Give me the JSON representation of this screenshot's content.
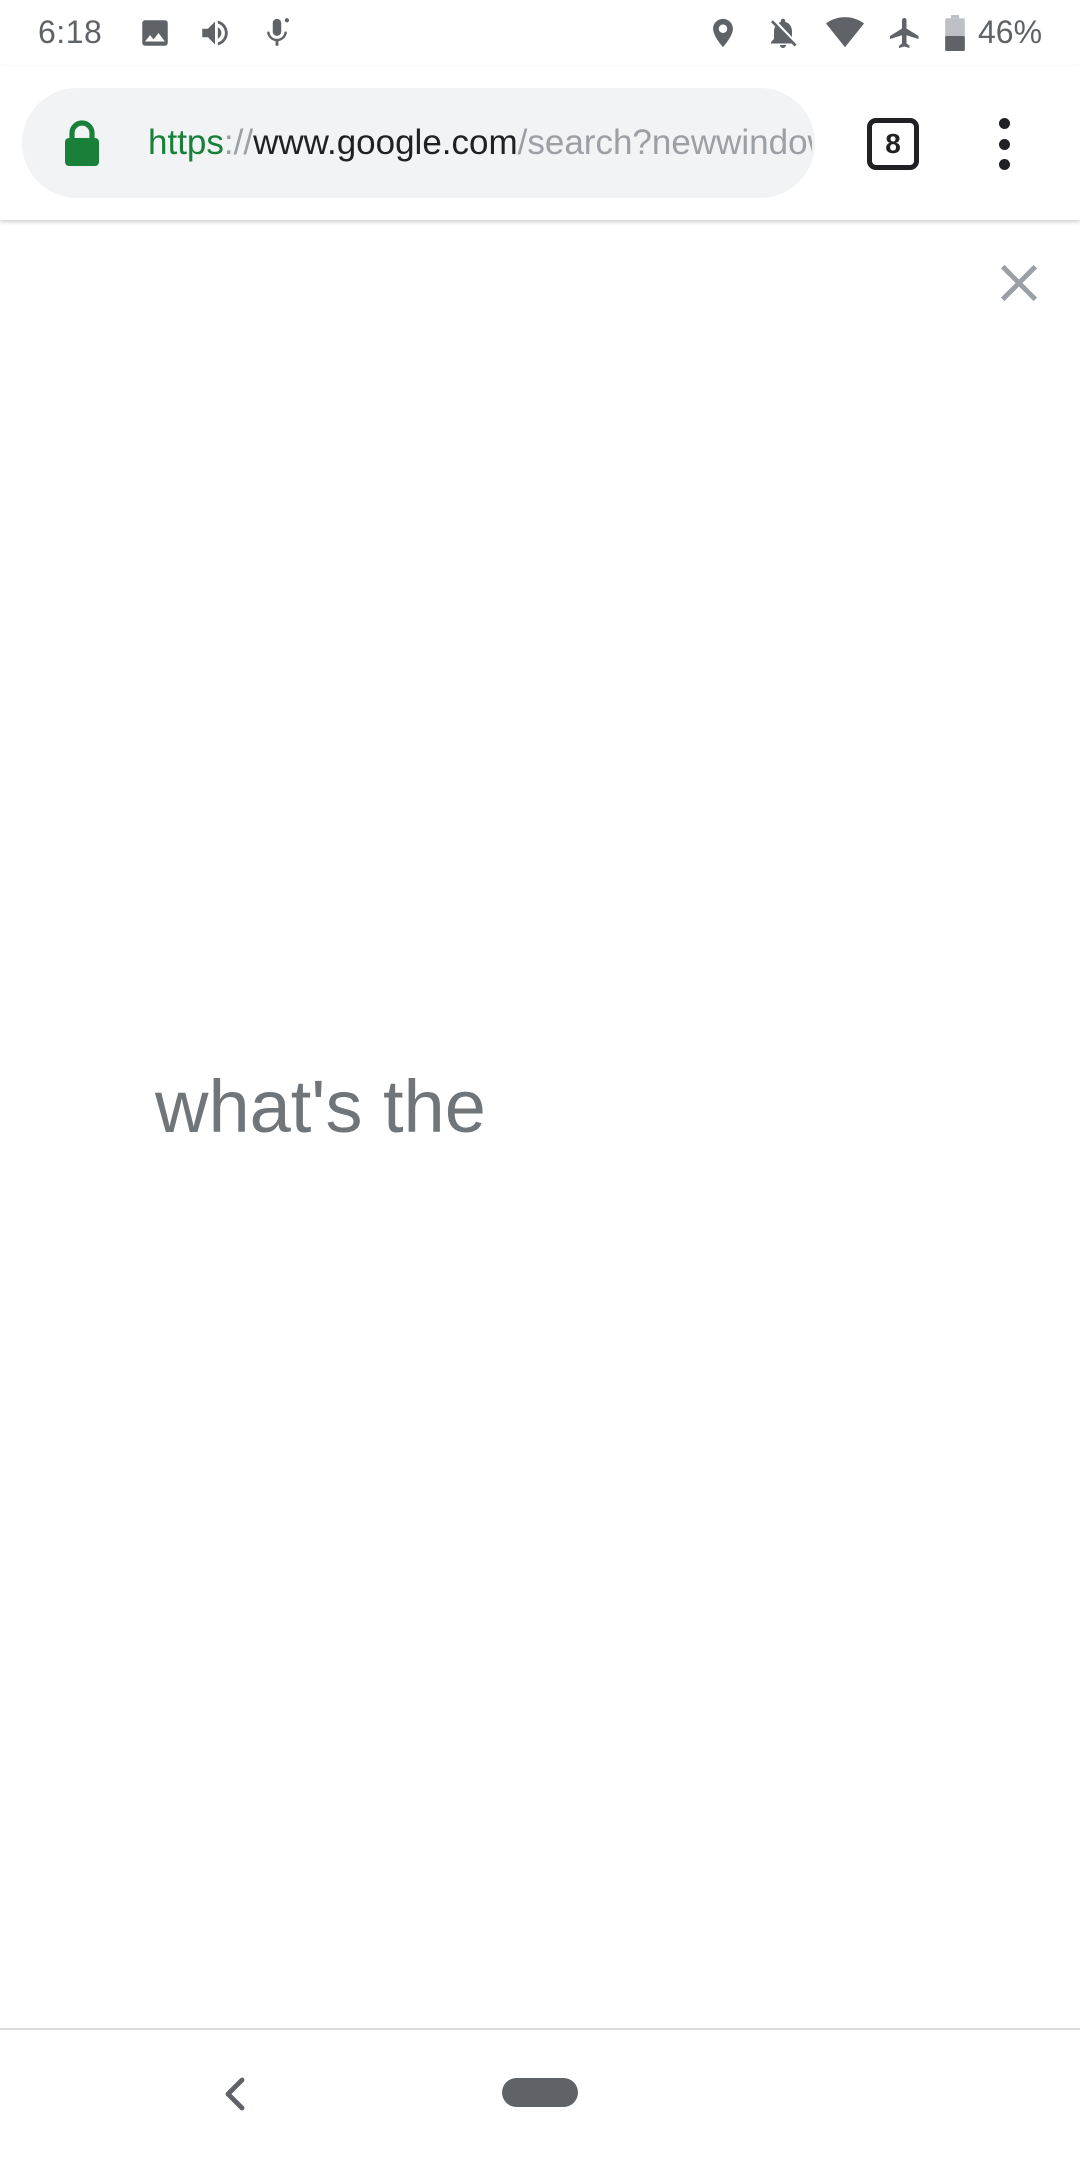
{
  "status_bar": {
    "time": "6:18",
    "battery_percent": "46%",
    "battery_level": 0.46,
    "icons": [
      "image-icon",
      "volume-icon",
      "mic-icon",
      "location-icon",
      "notifications-off-icon",
      "wifi-icon",
      "airplane-icon",
      "battery-icon"
    ]
  },
  "toolbar": {
    "url": {
      "scheme": "https",
      "separator": "://",
      "host": "www.google.com",
      "path": "/search?newwindow"
    },
    "tab_count": "8",
    "lock_icon": "lock-icon",
    "menu_icon": "more-vert-icon"
  },
  "content": {
    "query_text": "what's the",
    "close_icon": "close-icon"
  },
  "nav_bar": {
    "back_icon": "back-chevron-icon",
    "home_icon": "home-pill"
  },
  "colors": {
    "secure_green": "#188038",
    "url_host": "#202124",
    "url_muted": "#9aa0a6",
    "query_text": "#70757a",
    "pill_background": "#f1f3f4",
    "icon_gray": "#5f6368"
  }
}
